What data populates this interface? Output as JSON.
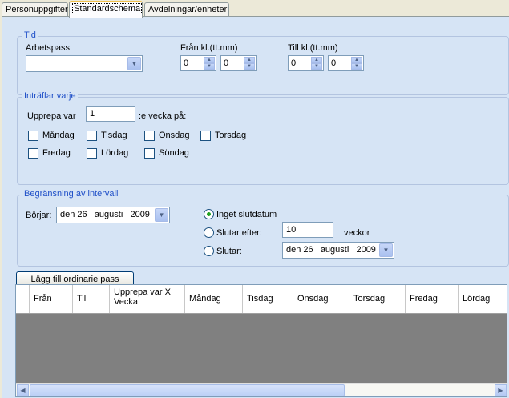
{
  "tabs": [
    "Personuppgifter",
    "Standardschema",
    "Avdelningar/enheter"
  ],
  "tid": {
    "legend": "Tid",
    "arbetspass_label": "Arbetspass",
    "arbetspass_value": "",
    "fran_label": "Från kl.(tt.mm)",
    "fran_hour": "0",
    "fran_min": "0",
    "till_label": "Till kl.(tt.mm)",
    "till_hour": "0",
    "till_min": "0"
  },
  "intraffar": {
    "legend": "Inträffar varje",
    "upprepa_label": "Upprepa var",
    "upprepa_value": "1",
    "vecka_suffix": ":e vecka på:",
    "days": [
      "Måndag",
      "Tisdag",
      "Onsdag",
      "Torsdag",
      "Fredag",
      "Lördag",
      "Söndag"
    ]
  },
  "intervall": {
    "legend": "Begränsning av intervall",
    "borjar_label": "Börjar:",
    "borjar_date": "den 26   augusti   2009",
    "opt_inget": "Inget slutdatum",
    "opt_efter": "Slutar efter:",
    "efter_value": "10",
    "efter_unit": "veckor",
    "opt_slutar": "Slutar:",
    "slutar_date": "den 26   augusti   2009",
    "selected": "Inget slutdatum"
  },
  "add_button": "Lägg till ordinarie pass",
  "grid": {
    "columns": [
      "Från",
      "Till",
      "Upprepa var X Vecka",
      "Måndag",
      "Tisdag",
      "Onsdag",
      "Torsdag",
      "Fredag",
      "Lördag"
    ]
  },
  "icons": {
    "dropdown": "chevron-down-icon",
    "spin_up": "triangle-up-icon",
    "spin_down": "triangle-down-icon",
    "scroll_left": "chevron-left-icon",
    "scroll_right": "chevron-right-icon"
  },
  "colors": {
    "panel_bg": "#d6e4f5",
    "legend_text": "#2050c8",
    "active_tab_accent": "#f1c14b",
    "grid_empty_bg": "#808080"
  }
}
